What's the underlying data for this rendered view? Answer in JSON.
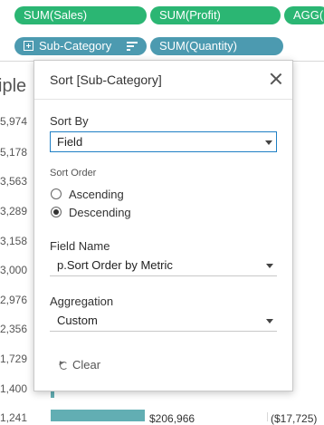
{
  "shelves": {
    "columns_pills": [
      "SUM(Sales)",
      "SUM(Profit)",
      "AGG("
    ],
    "rows_pills": [
      "Sub-Category",
      "SUM(Quantity)"
    ]
  },
  "background": {
    "title_fragment": "iple",
    "axis_labels": [
      "5,974",
      "5,178",
      "3,563",
      "3,289",
      "3,158",
      "3,000",
      "2,976",
      "2,356",
      "1,729",
      "1,400",
      "1,241"
    ],
    "value_labels": [
      "$206,966",
      "($17,725)"
    ]
  },
  "dialog": {
    "title": "Sort [Sub-Category]",
    "sort_by_label": "Sort By",
    "sort_by_value": "Field",
    "sort_order_label": "Sort Order",
    "options": [
      {
        "label": "Ascending",
        "checked": false
      },
      {
        "label": "Descending",
        "checked": true
      }
    ],
    "field_name_label": "Field Name",
    "field_name_value": "p.Sort Order by Metric",
    "aggregation_label": "Aggregation",
    "aggregation_value": "Custom",
    "clear_label": "Clear"
  },
  "colors": {
    "green_pill": "#2bb673",
    "blue_pill": "#4c9ab0",
    "bar": "#62aeb3",
    "focus_border": "#1f7fc4"
  }
}
